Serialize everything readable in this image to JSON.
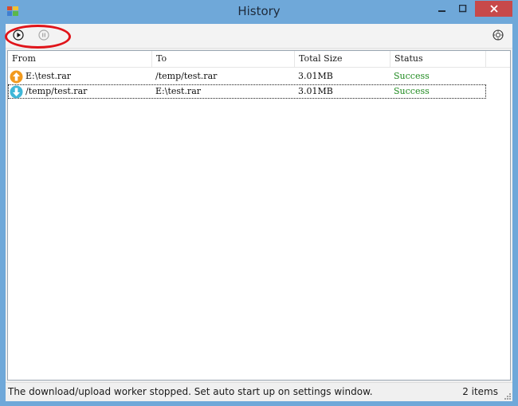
{
  "window": {
    "title": "History",
    "icons": {
      "app": "app-icon",
      "minimize": "minimize-icon",
      "maximize": "maximize-icon",
      "close": "close-icon"
    },
    "close_color": "#c7494a"
  },
  "toolbar": {
    "play_icon": "play-icon",
    "pause_icon": "pause-icon",
    "settings_icon": "settings-icon",
    "highlight_color": "#e0141a"
  },
  "list": {
    "columns": [
      "From",
      "To",
      "Total Size",
      "Status"
    ],
    "rows": [
      {
        "direction_icon": "upload-arrow-icon",
        "from": "E:\\test.rar",
        "to": "/temp/test.rar",
        "size": "3.01MB",
        "status": "Success"
      },
      {
        "direction_icon": "download-arrow-icon",
        "from": "/temp/test.rar",
        "to": "E:\\test.rar",
        "size": "3.01MB",
        "status": "Success"
      }
    ],
    "status_color": "#1f8a1f"
  },
  "statusbar": {
    "message": "The download/upload worker stopped. Set auto start up on settings window.",
    "count": "2 items"
  }
}
